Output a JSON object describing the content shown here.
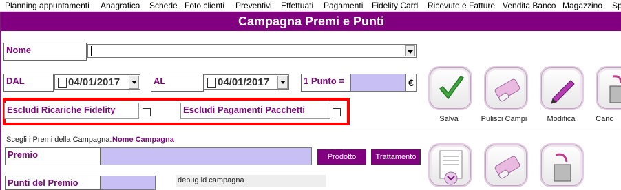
{
  "menu": [
    "Planning appuntamenti",
    "Anagrafica",
    "Schede",
    "Foto clienti",
    "Preventivi",
    "Effettuati",
    "Pagamenti",
    "Fidelity Card",
    "Ricevute e Fatture",
    "Vendita Banco",
    "Magazzino",
    "Sp"
  ],
  "title": "Campagna Premi e Punti",
  "nome": {
    "label": "Nome",
    "value": ""
  },
  "dal": {
    "label": "DAL",
    "value": "04/01/2017"
  },
  "al": {
    "label": "AL",
    "value": "04/01/2017"
  },
  "punto": {
    "label": "1 Punto =",
    "currency": "€"
  },
  "excl_fidelity": {
    "label": "Escludi Ricariche Fidelity",
    "checked": false
  },
  "excl_pacchetti": {
    "label": "Escludi Pagamenti Pacchetti",
    "checked": false
  },
  "buttons": {
    "salva": "Salva",
    "pulisci": "Pulisci Campi",
    "modifica": "Modifica",
    "canc": "Canc"
  },
  "premi_section": {
    "caption": "Scegli i Premi della Campagna:",
    "campagna_name": "Nome Campagna"
  },
  "premio": {
    "label": "Premio",
    "prodotto": "Prodotto",
    "trattamento": "Trattamento"
  },
  "punti_premio": {
    "label": "Punti del Premio"
  },
  "debug": "debug id campagna",
  "colors": {
    "accent": "#800080",
    "highlight": "#ff0000",
    "field": "#c8bff5"
  }
}
